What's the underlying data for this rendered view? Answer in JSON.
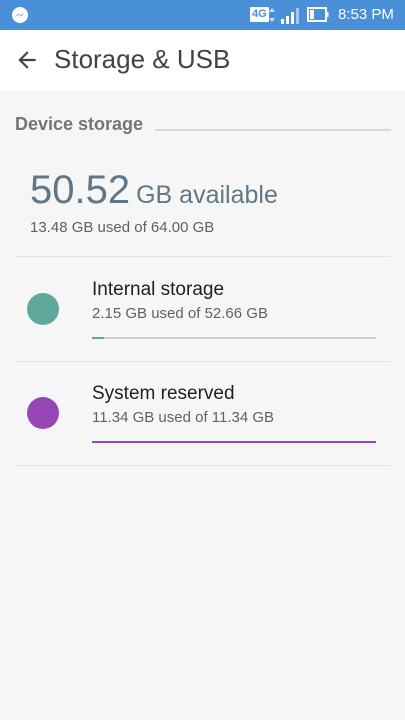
{
  "status_bar": {
    "time": "8:53 PM",
    "network": "4G",
    "bg_color": "#4a90d9"
  },
  "header": {
    "title": "Storage & USB",
    "back_icon": "arrow-back-icon"
  },
  "section": {
    "title": "Device storage"
  },
  "summary": {
    "available_value": "50.52",
    "available_unit": "GB available",
    "used_text": "13.48 GB used of 64.00 GB"
  },
  "volumes": [
    {
      "title": "Internal storage",
      "usage": "2.15 GB used of 52.66 GB",
      "fraction_used": 0.041,
      "color": "#5fa89b",
      "bar_color": "#5fa89b"
    },
    {
      "title": "System reserved",
      "usage": "11.34 GB used of 11.34 GB",
      "fraction_used": 1.0,
      "color": "#9747b5",
      "bar_color": "#9747b5"
    }
  ]
}
